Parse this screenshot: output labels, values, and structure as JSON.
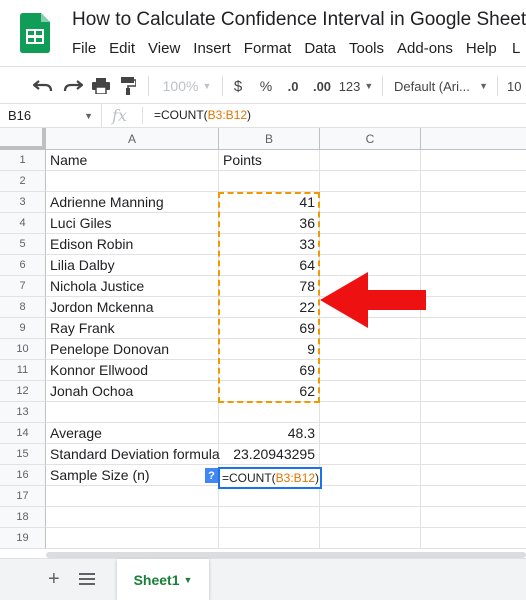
{
  "app": {
    "doc_title": "How to Calculate Confidence Interval in Google Sheets",
    "menu": [
      "File",
      "Edit",
      "View",
      "Insert",
      "Format",
      "Data",
      "Tools",
      "Add-ons",
      "Help"
    ],
    "menu_extra": "L"
  },
  "toolbar": {
    "zoom": "100%",
    "currency": "$",
    "percent": "%",
    "decrease_decimal": ".0",
    "increase_decimal": ".00",
    "more_formats": "123",
    "font": "Default (Ari...",
    "font_size": "10"
  },
  "formula_bar": {
    "name_box": "B16",
    "fx": "fx",
    "formula_prefix": "=COUNT(",
    "formula_range": "B3:B12",
    "formula_suffix": ")"
  },
  "columns": [
    "A",
    "B",
    "C"
  ],
  "rows": [
    "1",
    "2",
    "3",
    "4",
    "5",
    "6",
    "7",
    "8",
    "9",
    "10",
    "11",
    "12",
    "13",
    "14",
    "15",
    "16",
    "17",
    "18",
    "19"
  ],
  "cells": {
    "a1": "Name",
    "b1": "Points",
    "a3": "Adrienne Manning",
    "b3": "41",
    "a4": "Luci Giles",
    "b4": "36",
    "a5": "Edison Robin",
    "b5": "33",
    "a6": "Lilia Dalby",
    "b6": "64",
    "a7": "Nichola Justice",
    "b7": "78",
    "a8": "Jordon Mckenna",
    "b8": "22",
    "a9": "Ray Frank",
    "b9": "69",
    "a10": "Penelope Donovan",
    "b10": "9",
    "a11": "Konnor Ellwood",
    "b11": "69",
    "a12": "Jonah Ochoa",
    "b12": "62",
    "a14": "Average",
    "b14": "48.3",
    "a15": "Standard Deviation formula",
    "b15": "23.20943295",
    "a16": "Sample Size (n)"
  },
  "active_cell": {
    "help": "?",
    "formula_prefix": "=COUNT(",
    "formula_range": "B3:B12",
    "formula_suffix": ")"
  },
  "sheets": {
    "add": "+",
    "active_tab": "Sheet1"
  },
  "colors": {
    "accent_blue": "#1a73e8",
    "copy_range": "#f29900",
    "range_text": "#e37400",
    "sheet_green": "#188038",
    "arrow_red": "#ee1111"
  },
  "icons": [
    "sheets-logo-icon",
    "undo-icon",
    "redo-icon",
    "print-icon",
    "paint-format-icon",
    "all-sheets-icon",
    "red-arrow-annotation"
  ]
}
